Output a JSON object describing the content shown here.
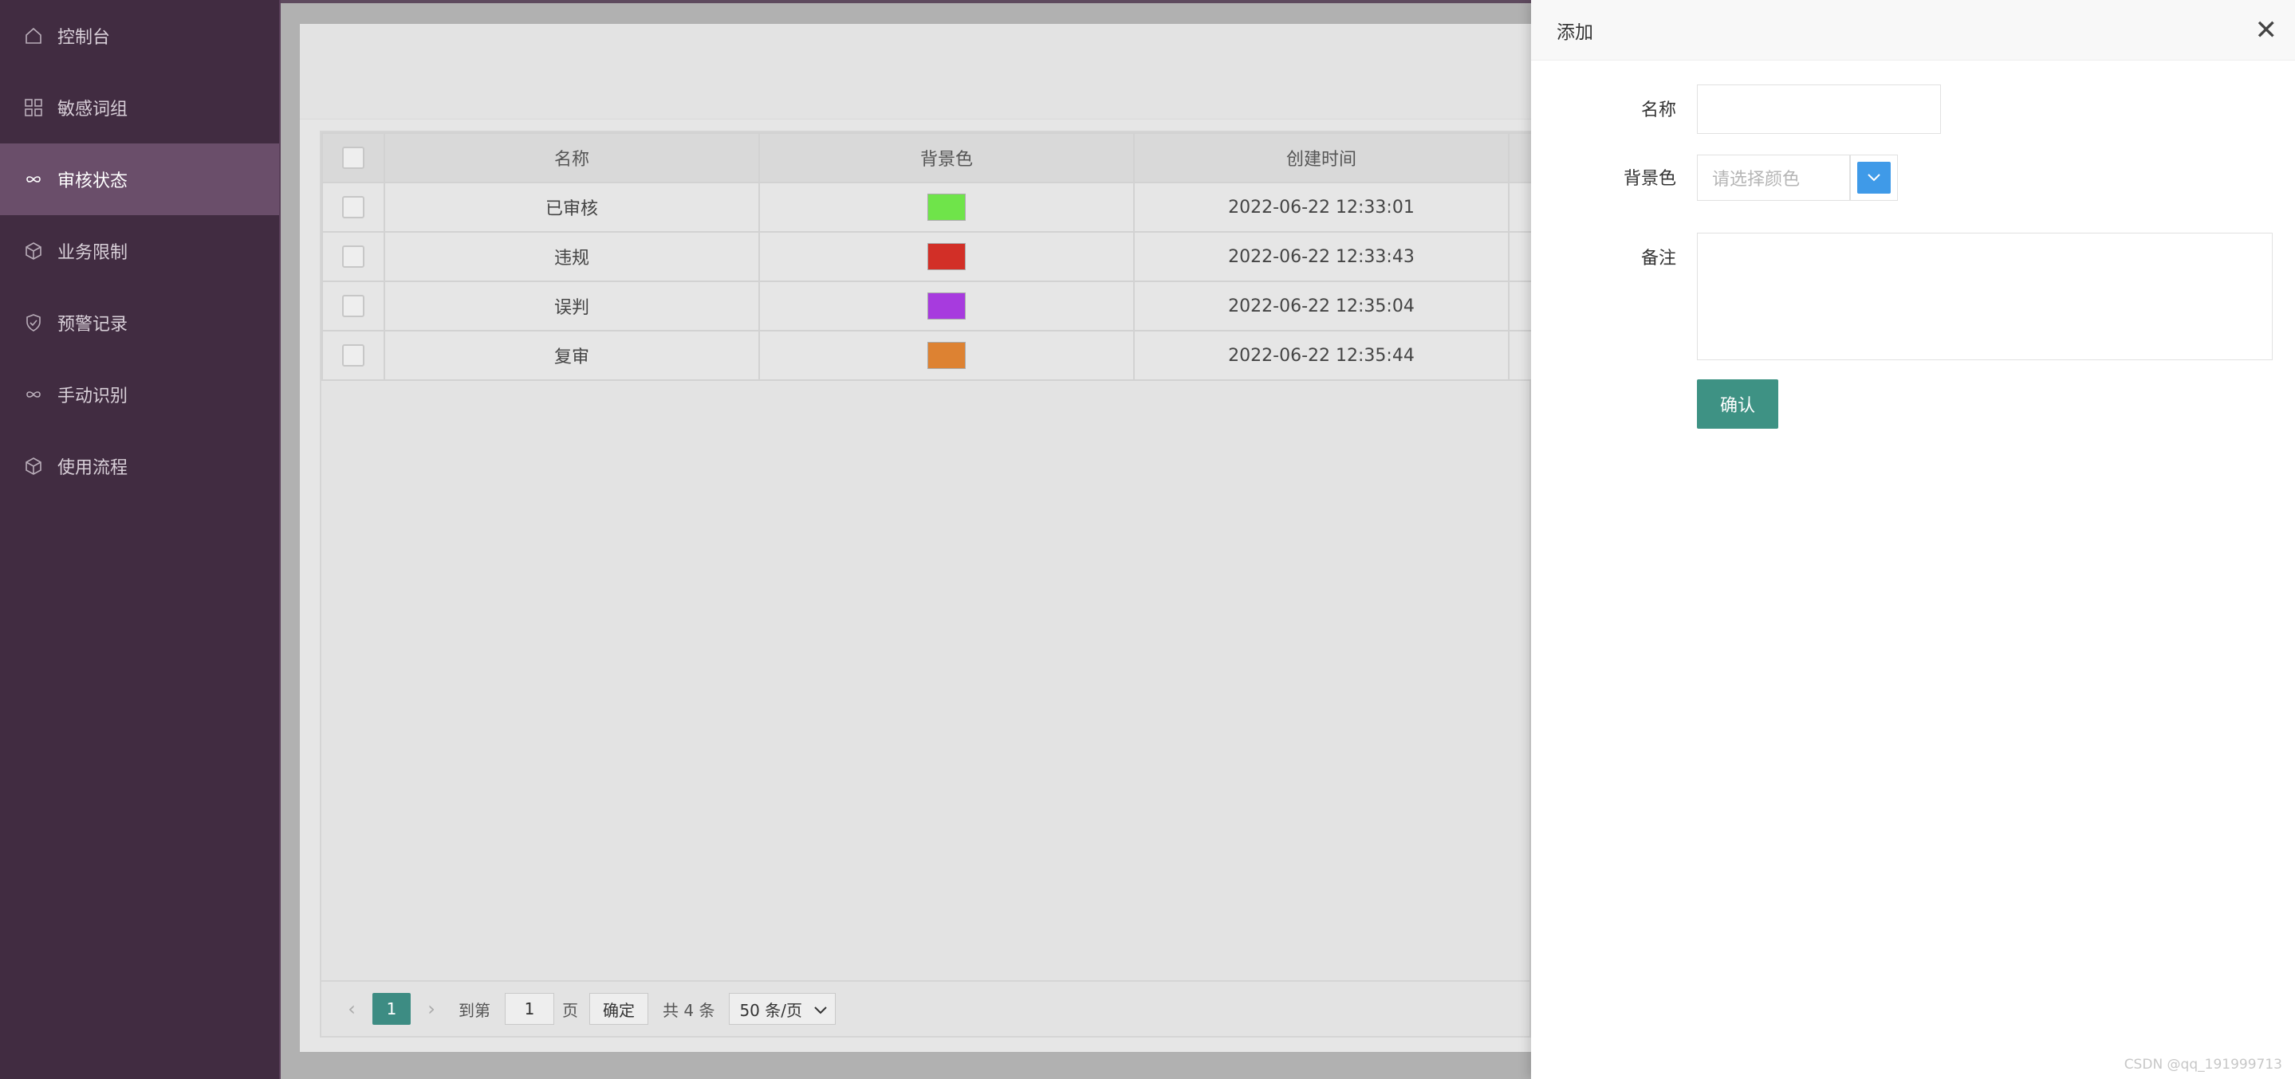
{
  "sidebar": {
    "items": [
      {
        "label": "控制台",
        "icon": "home-icon",
        "active": false
      },
      {
        "label": "敏感词组",
        "icon": "grid-icon",
        "active": false
      },
      {
        "label": "审核状态",
        "icon": "infinity-icon",
        "active": true
      },
      {
        "label": "业务限制",
        "icon": "cube-icon",
        "active": false
      },
      {
        "label": "预警记录",
        "icon": "shield-check-icon",
        "active": false
      },
      {
        "label": "手动识别",
        "icon": "infinity-icon",
        "active": false
      },
      {
        "label": "使用流程",
        "icon": "cube-icon",
        "active": false
      }
    ]
  },
  "table": {
    "columns": [
      "名称",
      "背景色",
      "创建时间"
    ],
    "rows": [
      {
        "name": "已审核",
        "color": "#6fe44a",
        "created": "2022-06-22 12:33:01"
      },
      {
        "name": "违规",
        "color": "#d22f27",
        "created": "2022-06-22 12:33:43"
      },
      {
        "name": "误判",
        "color": "#a73bde",
        "created": "2022-06-22 12:35:04"
      },
      {
        "name": "复审",
        "color": "#dd8232",
        "created": "2022-06-22 12:35:44"
      }
    ]
  },
  "pager": {
    "current_page": "1",
    "goto_label": "到第",
    "goto_value": "1",
    "page_unit": "页",
    "ok_label": "确定",
    "total_label": "共 4 条",
    "page_size": "50 条/页"
  },
  "drawer": {
    "title": "添加",
    "name_label": "名称",
    "name_value": "",
    "color_label": "背景色",
    "color_placeholder": "请选择颜色",
    "remark_label": "备注",
    "remark_value": "",
    "confirm_label": "确认"
  },
  "watermark": "CSDN @qq_191999713",
  "colors": {
    "sidebar_bg": "#412c41",
    "sidebar_active": "#6a4e6a",
    "primary": "#3e9284",
    "color_picker_blue": "#3f9ae8"
  }
}
